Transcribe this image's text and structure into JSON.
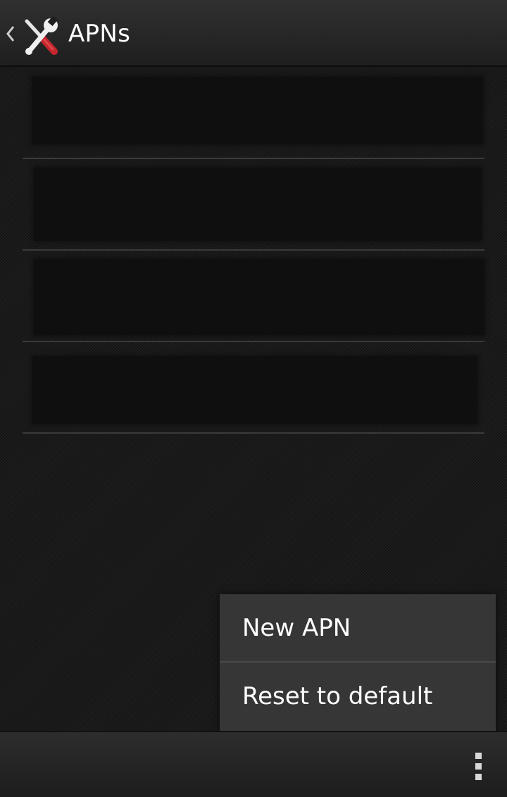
{
  "action_bar": {
    "title": "APNs",
    "back_icon": "chevron-left-icon",
    "app_icon": "wrench-screwdriver-icon"
  },
  "apn_list": {
    "items": [
      {
        "redacted": true
      },
      {
        "redacted": true
      },
      {
        "redacted": true
      },
      {
        "redacted": true
      }
    ]
  },
  "overflow_menu": {
    "items": [
      {
        "label": "New APN"
      },
      {
        "label": "Reset to default"
      }
    ]
  },
  "bottom_bar": {
    "overflow_icon": "more-vertical-icon"
  },
  "colors": {
    "accent_red": "#c1272d",
    "menu_background": "#363636",
    "divider": "#3a3a3a"
  }
}
